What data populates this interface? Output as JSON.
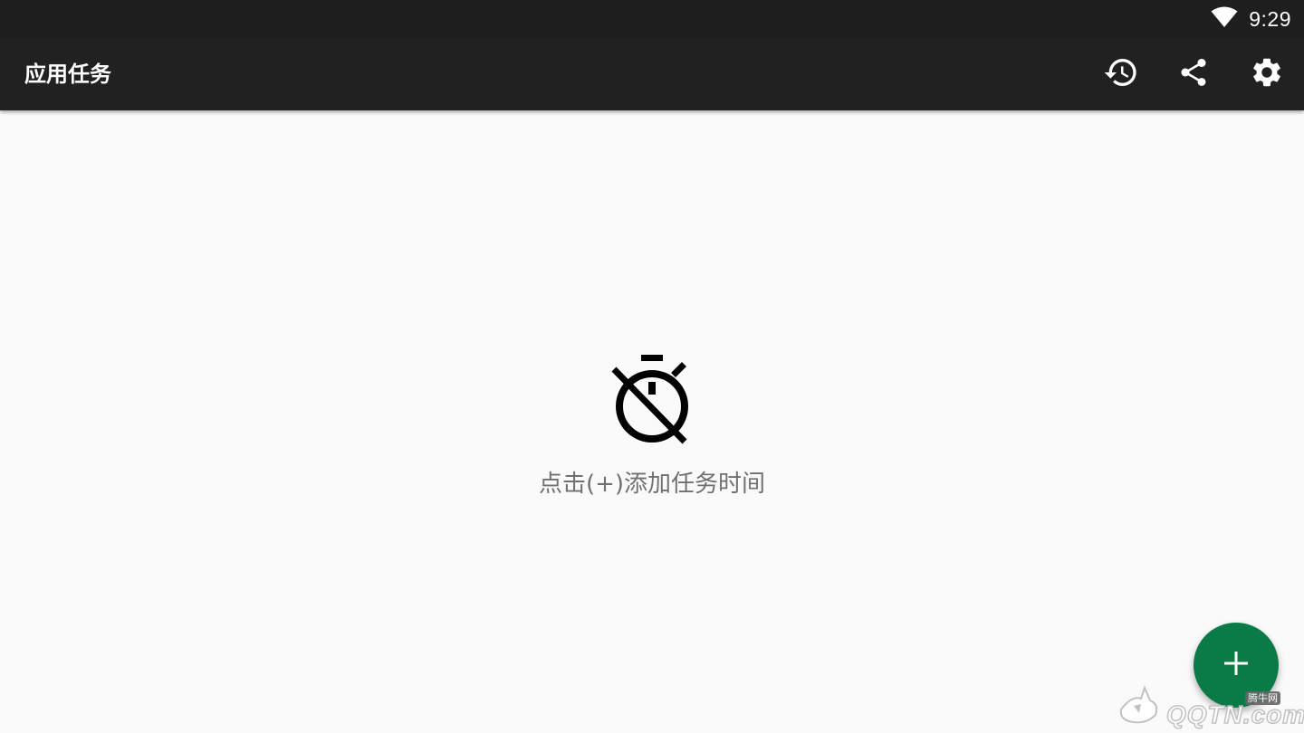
{
  "status_bar": {
    "time": "9:29",
    "wifi_icon": "wifi-icon"
  },
  "app_bar": {
    "title": "应用任务",
    "actions": [
      {
        "name": "history",
        "icon": "history-icon"
      },
      {
        "name": "share",
        "icon": "share-icon"
      },
      {
        "name": "settings",
        "icon": "gear-icon"
      }
    ]
  },
  "empty_state": {
    "icon": "timer-off-icon",
    "message": "点击(+)添加任务时间"
  },
  "fab": {
    "icon": "plus-icon",
    "color": "#0a7a46"
  },
  "watermark": {
    "text": "QQTN.com",
    "badge": "腾牛网"
  },
  "colors": {
    "status_bar": "#1e1e1e",
    "app_bar": "#212121",
    "background": "#fafafa",
    "message_text": "#707070"
  }
}
